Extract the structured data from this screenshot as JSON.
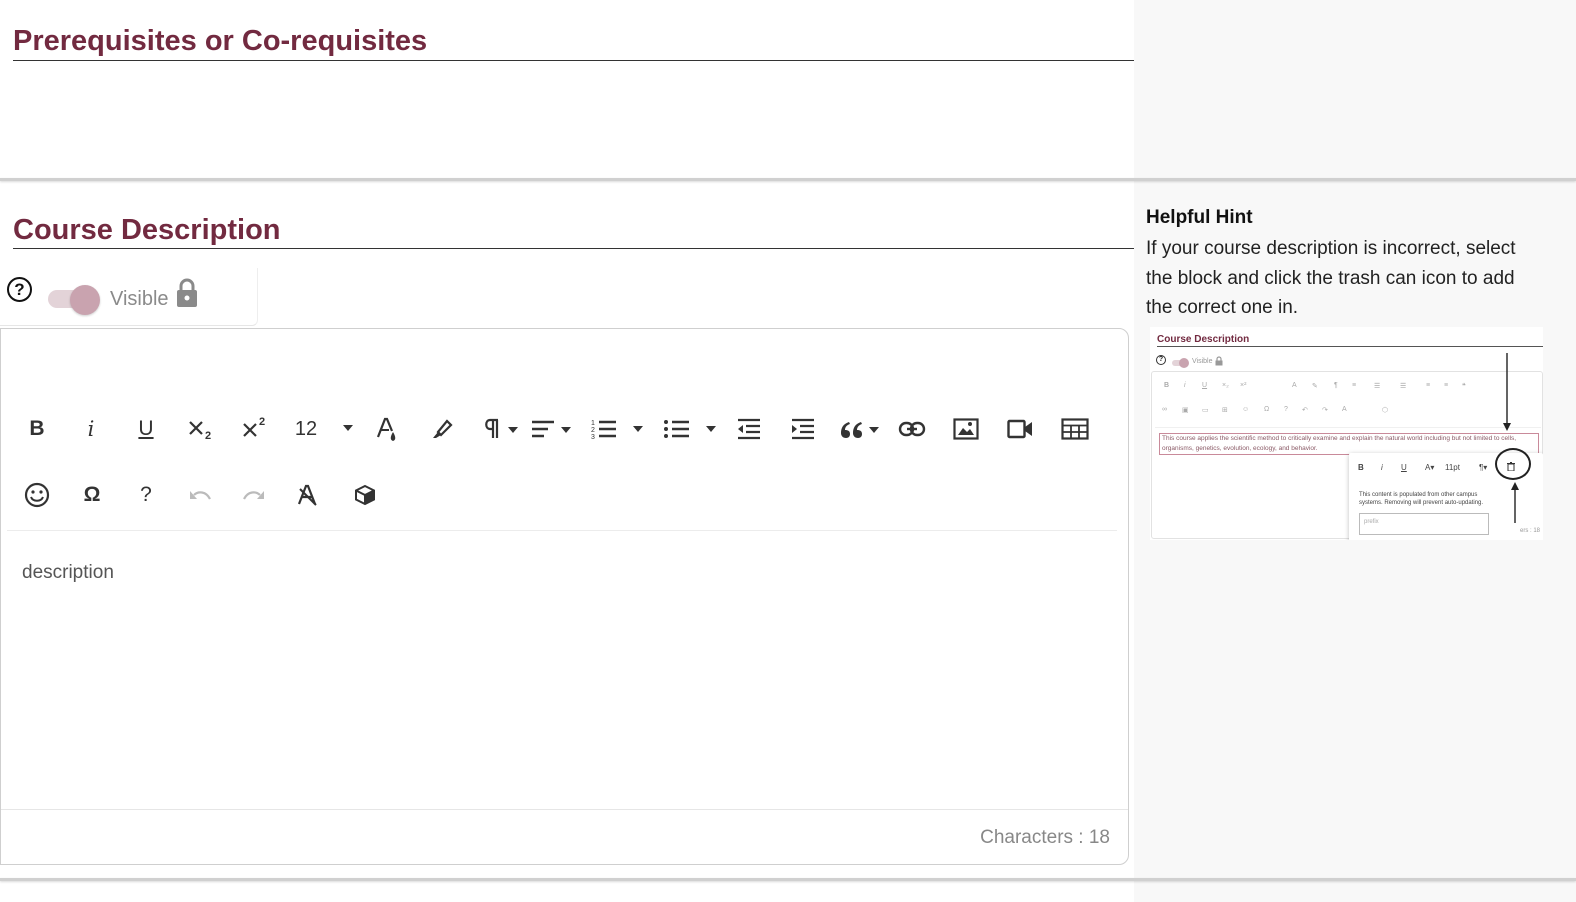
{
  "sections": {
    "prereq": {
      "title": "Prerequisites or Co-requisites"
    },
    "description": {
      "title": "Course Description",
      "visibility": {
        "label": "Visible",
        "state": "on-locked"
      },
      "toolbar": {
        "bold": "B",
        "italic": "i",
        "underline": "U",
        "font_size": "12",
        "omega": "Ω",
        "help": "?"
      },
      "content": "description",
      "char_label": "Characters : ",
      "char_count": "18"
    }
  },
  "hint": {
    "title": "Helpful Hint",
    "text": "If your course description is incorrect, select the block and click the trash can icon to add the correct one in.",
    "thumbnail": {
      "title": "Course Description",
      "visible_label": "Visible",
      "content": "This course applies the scientific method to critically examine and explain the natural world including but not limited to cells, organisms, genetics, evolution, ecology, and behavior.",
      "popup_text": "This content is populated from other campus systems. Removing will prevent auto-updating.",
      "popup_input": "prefix",
      "popup_font_size": "11pt",
      "chars_text": "ers : 18"
    }
  },
  "colors": {
    "title": "#722a40",
    "toggle_knob": "#c9a3af",
    "toggle_track": "#e3d3d8",
    "right_panel": "#f8f8f8"
  },
  "icons": [
    "help-circle-icon",
    "lock-icon",
    "bold-icon",
    "italic-icon",
    "underline-icon",
    "subscript-icon",
    "superscript-icon",
    "font-color-icon",
    "highlight-icon",
    "paragraph-icon",
    "align-icon",
    "ordered-list-icon",
    "unordered-list-icon",
    "outdent-icon",
    "indent-icon",
    "quote-icon",
    "link-icon",
    "image-icon",
    "video-icon",
    "table-icon",
    "emoji-icon",
    "special-char-icon",
    "help-icon",
    "undo-icon",
    "redo-icon",
    "clear-format-icon",
    "code-block-icon",
    "trash-icon"
  ]
}
